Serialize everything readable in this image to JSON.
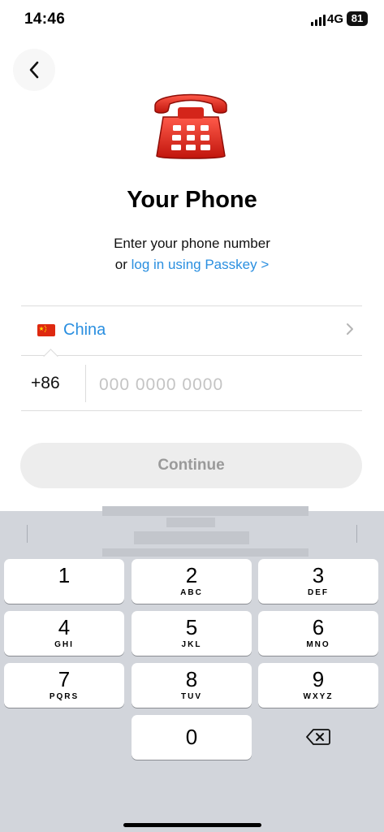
{
  "status_bar": {
    "time": "14:46",
    "network": "4G",
    "battery": "81"
  },
  "icons": {
    "back": "chevron-left-icon",
    "phone": "telephone-icon",
    "country_flag": "china-flag-icon",
    "row_chevron": "chevron-right-icon",
    "delete": "backspace-icon"
  },
  "header": {
    "title": "Your Phone",
    "subtitle_line1": "Enter your phone number",
    "subtitle_prefix": "or ",
    "passkey_link": "log in using Passkey",
    "passkey_arrow": ">"
  },
  "form": {
    "country": "China",
    "country_code": "+86",
    "phone_value": "",
    "phone_placeholder": "000 0000 0000",
    "continue_label": "Continue"
  },
  "colors": {
    "accent": "#2a8fe0",
    "keyboard_bg": "#d2d5db",
    "button_disabled": "#ededed"
  },
  "keypad": {
    "keys": [
      {
        "digit": "1",
        "letters": ""
      },
      {
        "digit": "2",
        "letters": "ABC"
      },
      {
        "digit": "3",
        "letters": "DEF"
      },
      {
        "digit": "4",
        "letters": "GHI"
      },
      {
        "digit": "5",
        "letters": "JKL"
      },
      {
        "digit": "6",
        "letters": "MNO"
      },
      {
        "digit": "7",
        "letters": "PQRS"
      },
      {
        "digit": "8",
        "letters": "TUV"
      },
      {
        "digit": "9",
        "letters": "WXYZ"
      },
      {
        "digit": "0",
        "letters": ""
      }
    ]
  }
}
